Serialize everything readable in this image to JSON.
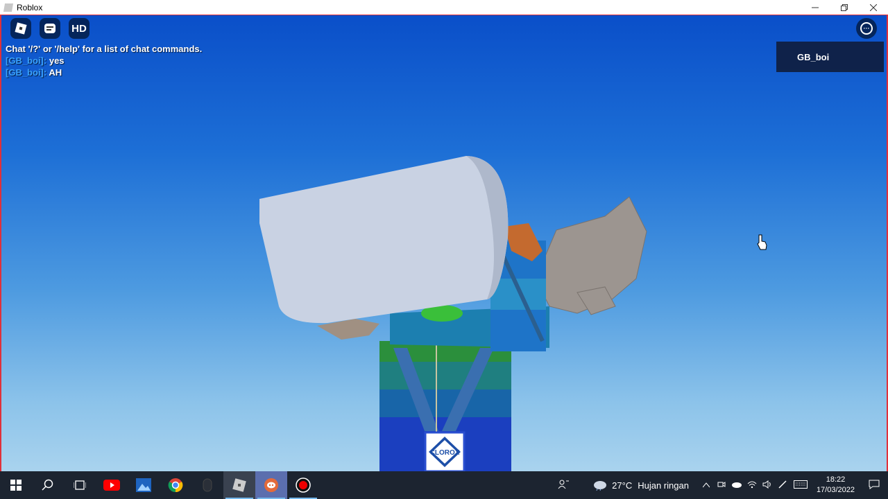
{
  "window": {
    "title": "Roblox",
    "controls": [
      "minimize-icon",
      "restore-icon",
      "close-icon"
    ]
  },
  "hud": {
    "hd_label": "HD",
    "more_glyph": "···"
  },
  "chat": {
    "system_message": "Chat '/?' or '/help' for a list of chat commands.",
    "messages": [
      {
        "name": "[GB_boi]:",
        "text": "yes"
      },
      {
        "name": "[GB_boi]:",
        "text": "AH"
      }
    ]
  },
  "playerlist": {
    "player": "GB_boi"
  },
  "scene": {
    "logo_text": "CLOROX"
  },
  "taskbar": {
    "apps": [
      "start-icon",
      "search-icon",
      "task-view-icon",
      "youtube-icon",
      "photos-icon",
      "chrome-icon",
      "mouse-app-icon",
      "roblox-icon",
      "discord-icon",
      "recorder-icon"
    ],
    "weather": {
      "temp": "27°C",
      "desc": "Hujan ringan"
    },
    "time": "18:22",
    "date": "17/03/2022"
  },
  "colors": {
    "sky_top": "#0a4fc9",
    "sky_bottom": "#a9d3ee",
    "window_border": "#e0303a",
    "taskbar": "#1c2430"
  }
}
